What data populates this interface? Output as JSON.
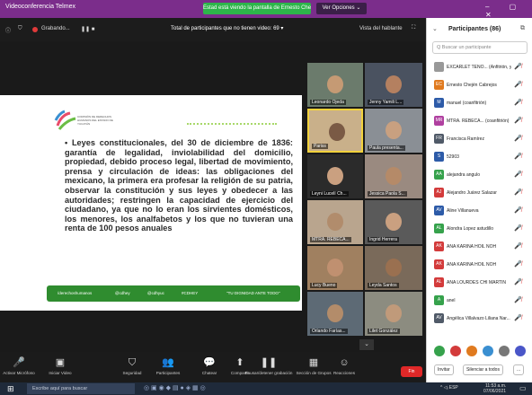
{
  "window": {
    "title": "Videoconferencia Telmex",
    "sharing_notice": "Estad está viendo la pantalla de Ernesto Chején Cabrejos",
    "view_options": "Ver Opciones ⌄",
    "controls": "–  ▢  ✕"
  },
  "zoom_top": {
    "speaker": "Grabando...",
    "participant_total": "Total de participantes que no tienen video: 69 ▾",
    "speaker_view": "Vista del hablante"
  },
  "slide": {
    "logo_text": "COMISIÓN DE DERECHOS HUMANOS DEL ESTADO DE YUCATÁN",
    "text": "• Leyes constitucionales, del 30 de diciembre de 1836: garantía de legalidad, inviolabilidad del domicilio, propiedad, debido proceso legal, libertad de movimiento, prensa y circulación de ideas: las obligaciones del mexicano, la primera era profesar la religión de su patria, observar la constitución y sus leyes y obedecer a las autoridades; restringen la capacidad de ejercicio del ciudadano, ya que no lo eran los sirvientes domésticos, los menores, los analfabetos y los que no tuvieran una renta de 100 pesos anuales",
    "footer": [
      "/derechoshumanos",
      "@cdhey",
      "@cdhyuc",
      "#CDHEY",
      "\"TU DIGNIDAD ANTE TODO\""
    ]
  },
  "gallery": [
    {
      "name": "Leonardo Ojeda"
    },
    {
      "name": "Jenny Yamili L..."
    },
    {
      "name": "Pariss"
    },
    {
      "name": "Paula presenta..."
    },
    {
      "name": "Leyni Lucelí Ch..."
    },
    {
      "name": "Jessica Paola S..."
    },
    {
      "name": "MTRA. REBECA..."
    },
    {
      "name": "Ingrid Herrera"
    },
    {
      "name": "Lucy Bueno"
    },
    {
      "name": "Leyda Santos"
    },
    {
      "name": "Orlando Farías..."
    },
    {
      "name": "Lilet González"
    }
  ],
  "toolbar": [
    {
      "label": "Activar Micrófono",
      "icon": "mic-off-icon",
      "glyph": "🎤"
    },
    {
      "label": "Iniciar Video",
      "icon": "video-off-icon",
      "glyph": "▣"
    },
    {
      "label": "Seguridad",
      "icon": "shield-icon",
      "glyph": "⛉"
    },
    {
      "label": "Participantes",
      "icon": "participants-icon",
      "glyph": "👥"
    },
    {
      "label": "Chatear",
      "icon": "chat-icon",
      "glyph": "💬"
    },
    {
      "label": "Compartir",
      "icon": "share-icon",
      "glyph": "⬆"
    },
    {
      "label": "Pausar/detener grabación",
      "icon": "record-icon",
      "glyph": "❚❚"
    },
    {
      "label": "Sección de Grupos",
      "icon": "breakout-icon",
      "glyph": "▦"
    },
    {
      "label": "Reacciones",
      "icon": "reaction-icon",
      "glyph": "☺"
    }
  ],
  "end_button": "Fin",
  "panel": {
    "title": "Participantes (86)",
    "search_placeholder": "Q Buscar un participante",
    "participants": [
      {
        "name": "EXCARLET TENO... (Anfitrión, yo)",
        "initials": "",
        "color": "#999"
      },
      {
        "name": "Ernesto Chején Cabrejos",
        "initials": "EC",
        "color": "#e07a1f"
      },
      {
        "name": "manuel (coanfitrión)",
        "initials": "M",
        "color": "#2d5ba8"
      },
      {
        "name": "MTRA. REBECA... (coanfitrión)",
        "initials": "MR",
        "color": "#b040a0"
      },
      {
        "name": "Francisca Ramírez",
        "initials": "FR",
        "color": "#505a68"
      },
      {
        "name": "52903",
        "initials": "S",
        "color": "#2d5ba8"
      },
      {
        "name": "alejandra angulo",
        "initials": "AA",
        "color": "#36a24c"
      },
      {
        "name": "Alejandro Juárez Salazar",
        "initials": "AJ",
        "color": "#d33b3b"
      },
      {
        "name": "Aline Villanueva",
        "initials": "AV",
        "color": "#2d5ba8"
      },
      {
        "name": "Alondra Lopez astudillo",
        "initials": "AL",
        "color": "#36a24c"
      },
      {
        "name": "ANA KARINA HOIL NOH",
        "initials": "AK",
        "color": "#d33b3b"
      },
      {
        "name": "ANA KARINA HOIL NOH",
        "initials": "AK",
        "color": "#d33b3b"
      },
      {
        "name": "ANA LOURDES CHI MARTIN",
        "initials": "AL",
        "color": "#d33b3b"
      },
      {
        "name": "anel",
        "initials": "A",
        "color": "#36a24c"
      },
      {
        "name": "Angélica Villalvazo Liliana Nar...",
        "initials": "AV",
        "color": "#505a68"
      }
    ],
    "invite": "Invitar",
    "mute_all": "Silenciar a todos",
    "more": "..."
  },
  "taskbar": {
    "search": "Escribe aquí para buscar",
    "time": "11:53 a.m.",
    "date": "07/06/2021",
    "system": "^ ◁ᵢ ESP"
  }
}
